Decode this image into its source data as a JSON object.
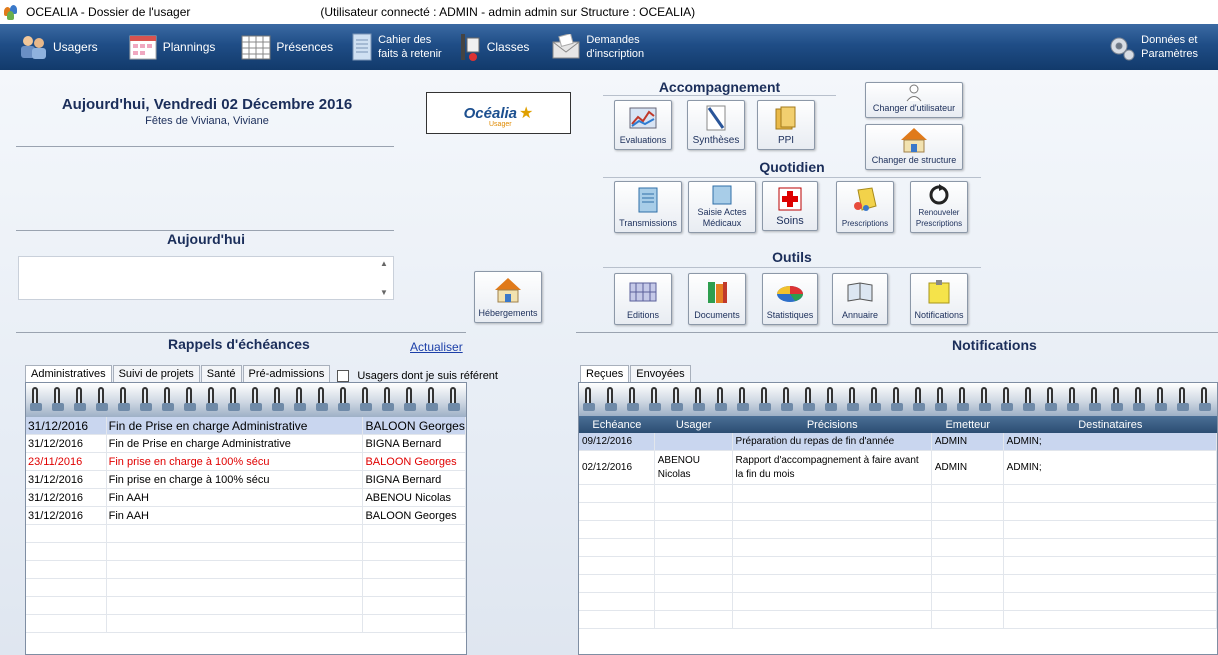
{
  "window": {
    "title": "OCEALIA - Dossier de l'usager",
    "user_info": "(Utilisateur connecté : ADMIN - admin admin sur Structure : OCEALIA)"
  },
  "toolbar": {
    "usagers": "Usagers",
    "plannings": "Plannings",
    "presences": "Présences",
    "cahier_line1": "Cahier des",
    "cahier_line2": "faits à retenir",
    "classes": "Classes",
    "demandes_line1": "Demandes",
    "demandes_line2": "d'inscription",
    "donnees_line1": "Données et",
    "donnees_line2": "Paramètres"
  },
  "header": {
    "date": "Aujourd'hui, Vendredi 02 Décembre 2016",
    "fetes": "Fêtes de Viviana, Viviane",
    "logo": "Océalia",
    "logo_sub": "Usager",
    "today_title": "Aujourd'hui"
  },
  "accompagnement": {
    "title": "Accompagnement",
    "evaluations": "Evaluations",
    "syntheses": "Synthèses",
    "ppi": "PPI"
  },
  "quotidien": {
    "title": "Quotidien",
    "transmissions": "Transmissions",
    "saisie_line1": "Saisie Actes",
    "saisie_line2": "Médicaux",
    "soins": "Soins",
    "prescriptions": "Prescriptions",
    "renouveler_line1": "Renouveler",
    "renouveler_line2": "Prescriptions"
  },
  "outils": {
    "title": "Outils",
    "editions": "Editions",
    "documents": "Documents",
    "statistiques": "Statistiques",
    "annuaire": "Annuaire",
    "notifications": "Notifications"
  },
  "side_buttons": {
    "changer_utilisateur": "Changer d'utilisateur",
    "changer_structure": "Changer de structure",
    "hebergements": "Hébergements"
  },
  "rappels": {
    "title": "Rappels d'échéances",
    "actualiser": "Actualiser",
    "tabs": [
      "Administratives",
      "Suivi de projets",
      "Santé",
      "Pré-admissions"
    ],
    "checkbox_label": "Usagers dont je suis référent",
    "rows": [
      {
        "date": "31/12/2016",
        "label": "Fin de Prise en charge Administrative",
        "usager": "BALOON Georges"
      },
      {
        "date": "31/12/2016",
        "label": "Fin de Prise en charge Administrative",
        "usager": "BIGNA Bernard"
      },
      {
        "date": "23/11/2016",
        "label": "Fin prise en charge à 100% sécu",
        "usager": "BALOON Georges"
      },
      {
        "date": "31/12/2016",
        "label": "Fin prise en charge à 100% sécu",
        "usager": "BIGNA Bernard"
      },
      {
        "date": "31/12/2016",
        "label": "Fin AAH",
        "usager": "ABENOU Nicolas"
      },
      {
        "date": "31/12/2016",
        "label": "Fin AAH",
        "usager": "BALOON Georges"
      }
    ]
  },
  "notifications": {
    "title": "Notifications",
    "tabs": [
      "Reçues",
      "Envoyées"
    ],
    "columns": [
      "Echéance",
      "Usager",
      "Précisions",
      "Emetteur",
      "Destinataires"
    ],
    "rows": [
      {
        "echeance": "09/12/2016",
        "usager": "",
        "precisions": "Préparation du repas de fin d'année",
        "emetteur": "ADMIN",
        "destinataires": "ADMIN;"
      },
      {
        "echeance": "02/12/2016",
        "usager": "ABENOU Nicolas",
        "precisions": "Rapport d'accompagnement à faire avant la fin du mois",
        "emetteur": "ADMIN",
        "destinataires": "ADMIN;"
      }
    ]
  }
}
